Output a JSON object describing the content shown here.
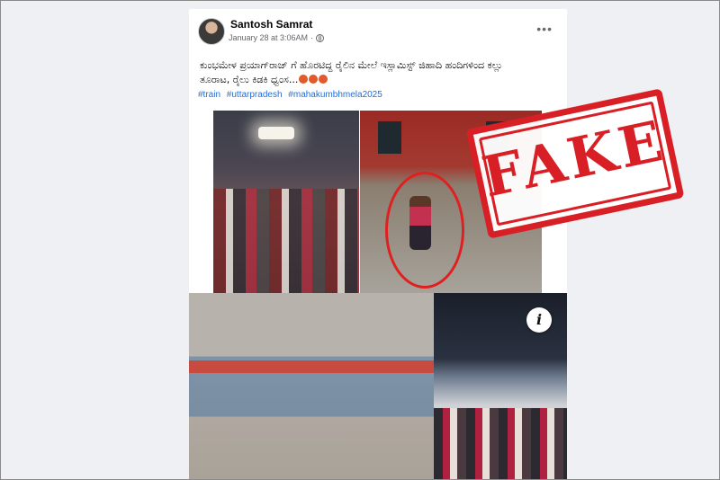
{
  "post": {
    "author": "Santosh Samrat",
    "timestamp": "January 28 at 3:06AM",
    "caption": "ಕುಂಭಮೇಳ ಪ್ರಯಾಗ್‌ರಾಜ್ ಗೆ ಹೊರಟಿದ್ದ ರೈಲಿನ ಮೇಲೆ ಇಸ್ಲಾಮಿಸ್ಟ್ ಜಿಹಾದಿ ಹಂದಿಗಳಿಂದ ಕಲ್ಲು ತೂರಾಟ, ರೈಲು ಕಿಡಕಿ ಧ್ವಂಸ...",
    "hashtags": [
      "#train",
      "#uttarpradesh",
      "#mahakumbhmela2025"
    ],
    "more_icon": "more-horizontal-icon",
    "privacy_icon": "globe-icon"
  },
  "overlay": {
    "stamp_text": "FAKE",
    "stamp_color": "#d91f26",
    "info_icon": "i"
  },
  "colors": {
    "hashtag": "#216fdb",
    "background": "#eef0f3"
  }
}
